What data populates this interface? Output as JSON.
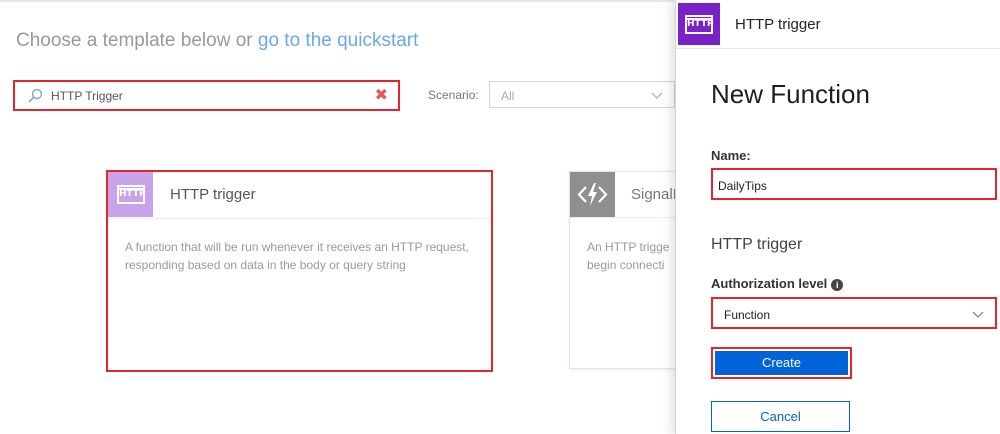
{
  "heading": {
    "prefix": "Choose a template below or",
    "link": "go to the quickstart"
  },
  "search": {
    "value": "HTTP Trigger",
    "icon": "search-icon",
    "clear_icon": "clear-icon"
  },
  "scenario": {
    "label": "Scenario:",
    "selected": "All"
  },
  "templates": [
    {
      "title": "HTTP trigger",
      "icon_text": "HTTP",
      "description": "A function that will be run whenever it receives an HTTP request, responding based on data in the body or query string",
      "icon_color": "#c9a3ea"
    },
    {
      "title": "SignalR",
      "description_line1": "An HTTP trigge",
      "description_line2": "begin connecti",
      "icon_color": "#8f8f8f"
    }
  ],
  "blade": {
    "header_title": "HTTP trigger",
    "header_icon_text": "HTTP",
    "header_icon_color": "#7a21c7",
    "title": "New Function",
    "name_label": "Name:",
    "name_value": "DailyTips",
    "section_title": "HTTP trigger",
    "auth_label": "Authorization level",
    "auth_value": "Function",
    "create_label": "Create",
    "cancel_label": "Cancel"
  },
  "colors": {
    "highlight": "#e2262b",
    "primary": "#0064d8",
    "link": "#6aa8e6"
  }
}
